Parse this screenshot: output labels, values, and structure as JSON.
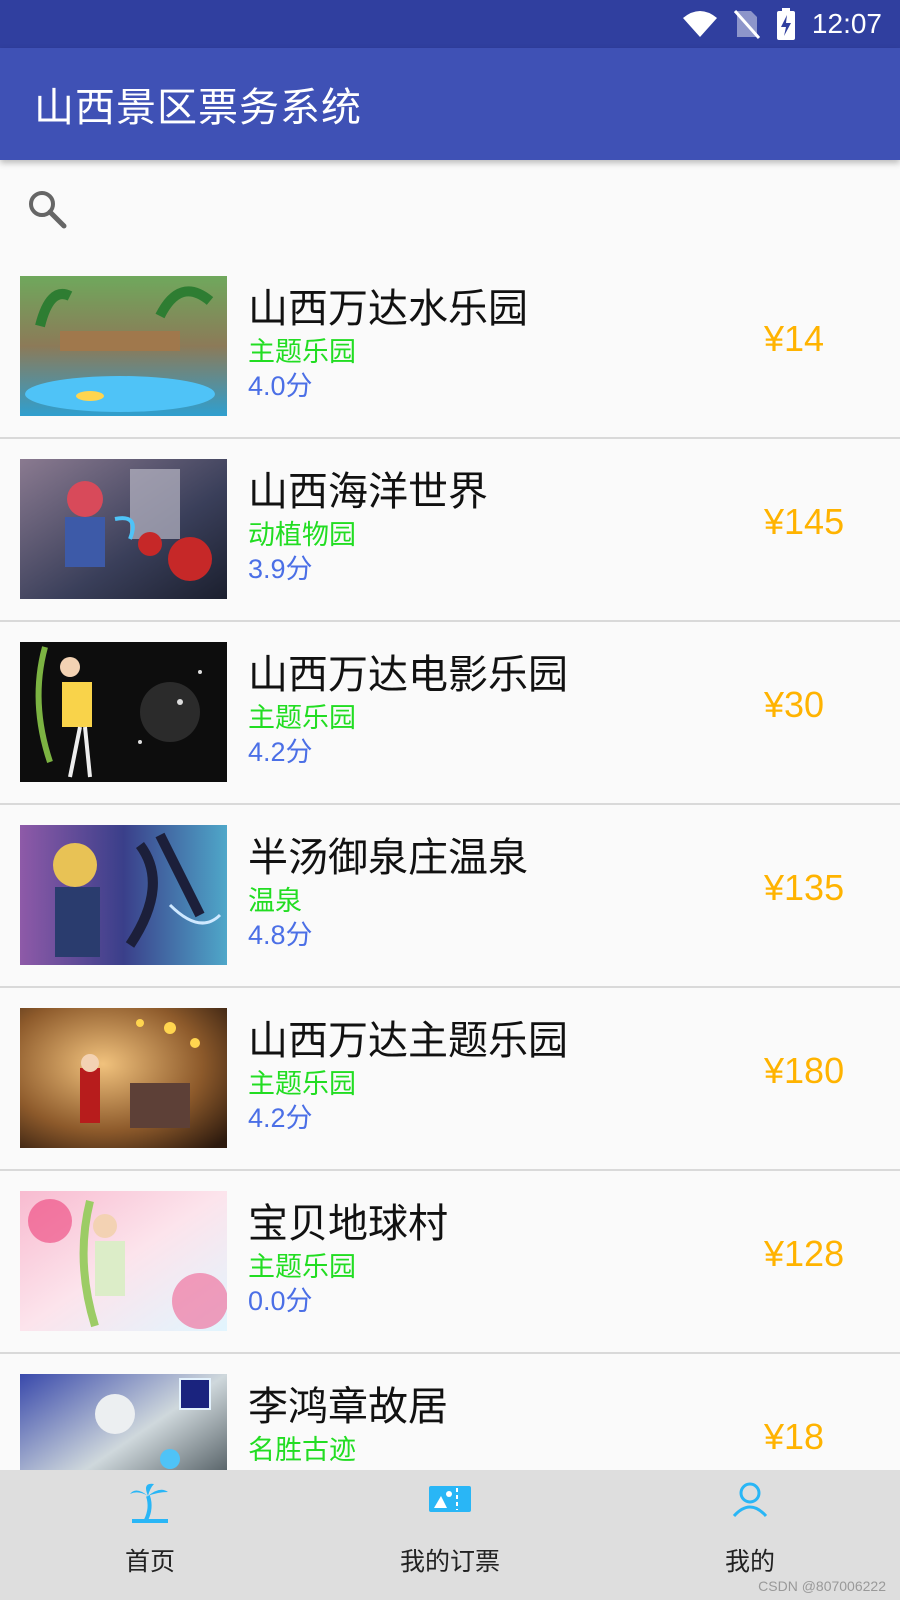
{
  "status_bar": {
    "time": "12:07"
  },
  "app_bar": {
    "title": "山西景区票务系统"
  },
  "search": {
    "icon": "search-icon"
  },
  "scenic_spots": [
    {
      "name": "山西万达水乐园",
      "category": "主题乐园",
      "score": "4.0分",
      "price": "¥14"
    },
    {
      "name": "山西海洋世界",
      "category": "动植物园",
      "score": "3.9分",
      "price": "¥145"
    },
    {
      "name": "山西万达电影乐园",
      "category": "主题乐园",
      "score": "4.2分",
      "price": "¥30"
    },
    {
      "name": "半汤御泉庄温泉",
      "category": "温泉",
      "score": "4.8分",
      "price": "¥135"
    },
    {
      "name": "山西万达主题乐园",
      "category": "主题乐园",
      "score": "4.2分",
      "price": "¥180"
    },
    {
      "name": "宝贝地球村",
      "category": "主题乐园",
      "score": "0.0分",
      "price": "¥128"
    },
    {
      "name": "李鸿章故居",
      "category": "名胜古迹",
      "score": "",
      "price": "¥18"
    }
  ],
  "bottom_nav": [
    {
      "label": "首页",
      "icon": "palm-tree-icon"
    },
    {
      "label": "我的订票",
      "icon": "ticket-icon"
    },
    {
      "label": "我的",
      "icon": "person-icon"
    }
  ],
  "watermark": "CSDN @807006222",
  "colors": {
    "status_bar": "#303f9f",
    "app_bar": "#3f51b5",
    "category": "#22dd22",
    "score": "#4b6fe6",
    "price": "#ffb300",
    "nav_icon": "#29b6f6"
  }
}
